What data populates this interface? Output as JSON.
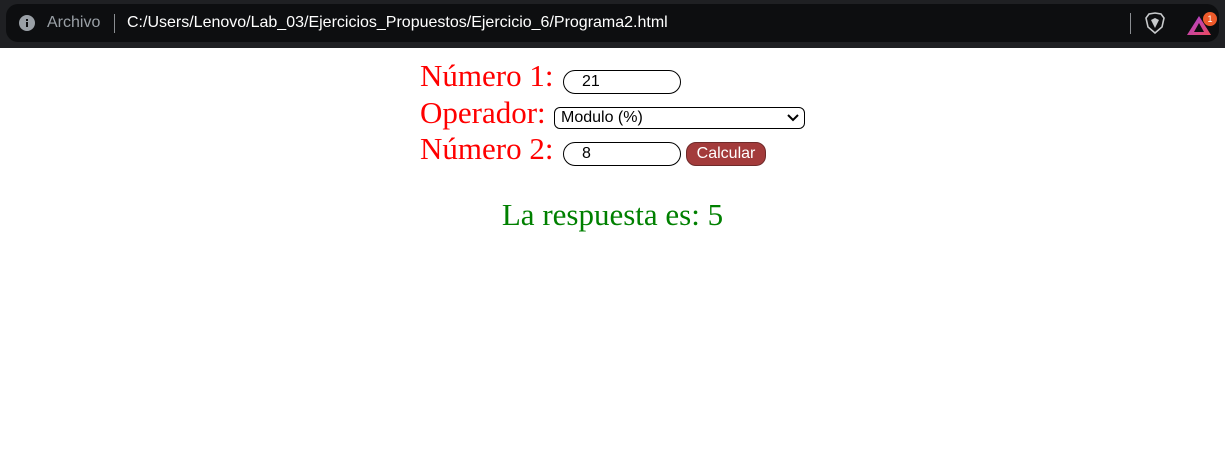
{
  "browser": {
    "security_label": "Archivo",
    "url": "C:/Users/Lenovo/Lab_03/Ejercicios_Propuestos/Ejercicio_6/Programa2.html",
    "rewards_badge": "1",
    "icons": [
      "info-icon",
      "brave-shields-icon",
      "brave-rewards-icon"
    ]
  },
  "form": {
    "numero1_label": "Número 1:",
    "numero1_value": "21",
    "operador_label": "Operador:",
    "operador_selected": "Modulo (%)",
    "numero2_label": "Número 2:",
    "numero2_value": "8",
    "calcular_label": "Calcular"
  },
  "result": {
    "text": "La respuesta es: 5"
  },
  "colors": {
    "label": "#ff0000",
    "result": "#008000",
    "button": "#a33b3b"
  }
}
